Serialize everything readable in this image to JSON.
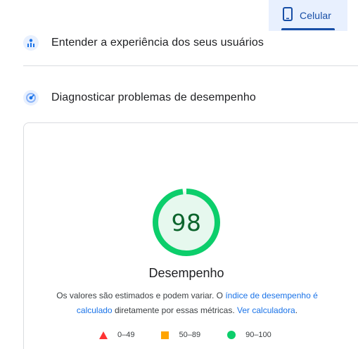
{
  "device_tabs": {
    "mobile": {
      "label": "Celular",
      "icon": "smartphone-icon",
      "selected": true
    }
  },
  "sections": {
    "user_experience": {
      "title": "Entender a experiência dos seus usuários",
      "icon": "users-chart-icon"
    },
    "diagnose": {
      "title": "Diagnosticar problemas de desempenho",
      "icon": "speed-gauge-icon"
    }
  },
  "score": {
    "value": "98",
    "score_fraction": 0.98,
    "title": "Desempenho",
    "color": "#0cce6b",
    "text_color": "#0d652d"
  },
  "note": {
    "part1": "Os valores são estimados e podem variar. O ",
    "link1": "índice de desempenho é calculado",
    "part2": " diretamente por essas métricas. ",
    "link2": "Ver calculadora",
    "part3": "."
  },
  "legend": [
    {
      "range": "0–49",
      "shape": "triangle",
      "color": "#ff3333"
    },
    {
      "range": "50–89",
      "shape": "square",
      "color": "#ffa400"
    },
    {
      "range": "90–100",
      "shape": "circle",
      "color": "#0cce6b"
    }
  ]
}
